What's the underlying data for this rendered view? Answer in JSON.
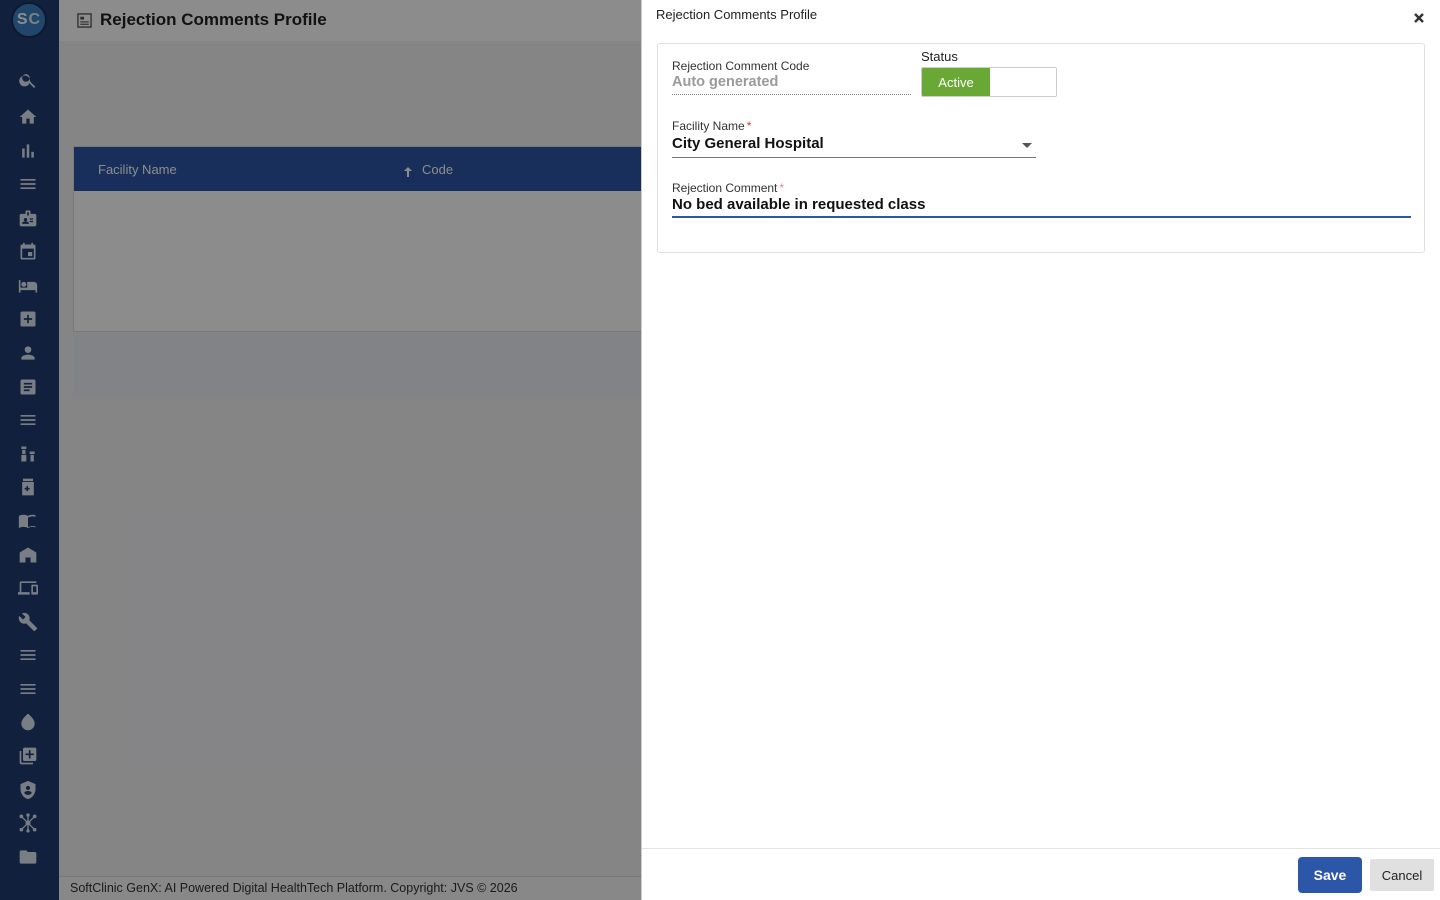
{
  "app": {
    "logo_letters": [
      "S",
      "C"
    ],
    "page_title": "Rejection Comments Profile",
    "footer": "SoftClinic GenX: AI Powered Digital HealthTech Platform. Copyright: JVS © 2026"
  },
  "sidebar": {
    "icons": [
      "search-icon",
      "home-icon",
      "bar-chart-icon",
      "menu-icon",
      "id-badge-icon",
      "calendar-icon",
      "bed-icon",
      "medical-plus-icon",
      "person-icon",
      "document-icon",
      "menu-icon",
      "medication-icon",
      "pharmacy-icon",
      "book-icon",
      "building-icon",
      "devices-icon",
      "wrench-icon",
      "menu-icon",
      "menu-icon",
      "drop-icon",
      "add-library-icon",
      "shield-icon",
      "network-icon",
      "folder-icon"
    ]
  },
  "grid": {
    "columns": [
      "Facility Name",
      "Code"
    ]
  },
  "panel": {
    "title": "Rejection Comments Profile",
    "code": {
      "label": "Rejection Comment Code",
      "value": "Auto generated"
    },
    "status": {
      "label": "Status",
      "active_label": "Active"
    },
    "facility": {
      "label": "Facility Name",
      "required_mark": "*",
      "value": "City General Hospital"
    },
    "comment": {
      "label": "Rejection Comment",
      "required_mark": "*",
      "value": "No bed available in requested class"
    },
    "save_label": "Save",
    "cancel_label": "Cancel"
  },
  "colors": {
    "sidebar": "#1f3b6e",
    "primary": "#2c56a8",
    "active_green": "#6aa835"
  }
}
